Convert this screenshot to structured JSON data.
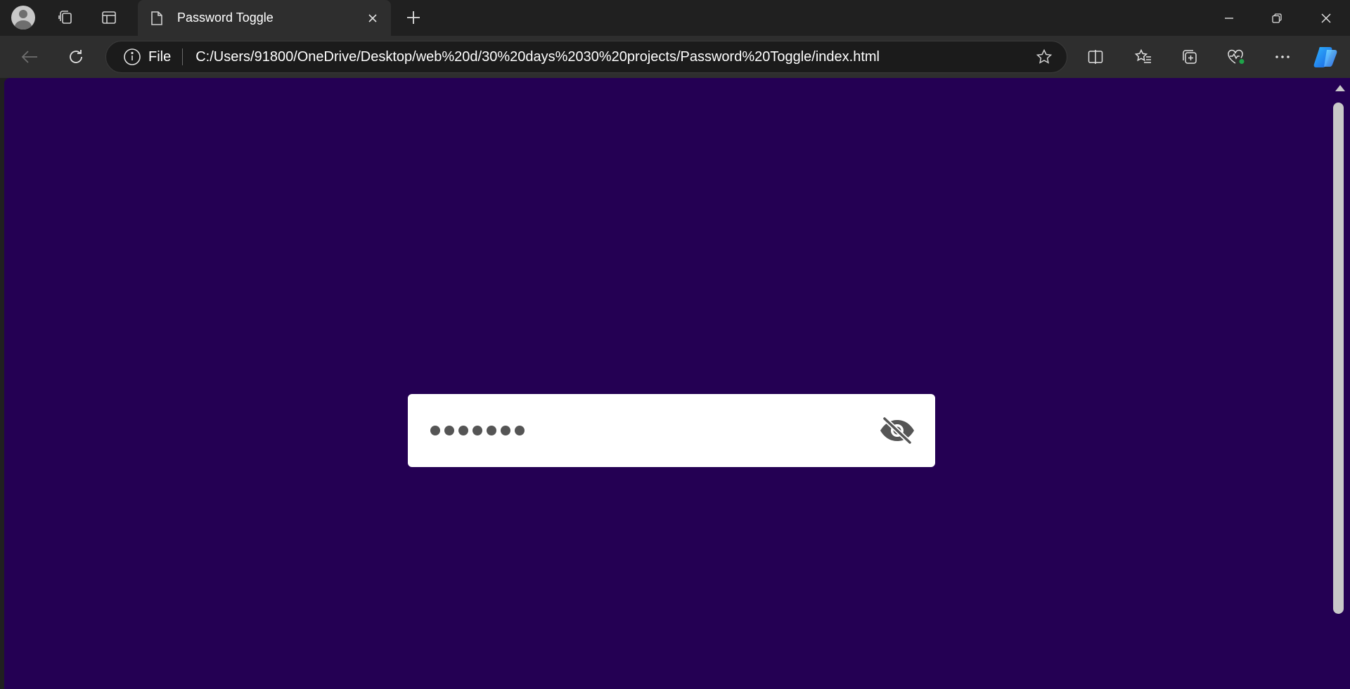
{
  "tab": {
    "title": "Password Toggle"
  },
  "address": {
    "scheme_label": "File",
    "url": "C:/Users/91800/OneDrive/Desktop/web%20d/30%20days%2030%20projects/Password%20Toggle/index.html"
  },
  "page": {
    "background": "#240053",
    "password": {
      "masked_length": 7,
      "dots": "•••••••"
    },
    "toggle_icon": "eye-slash-icon"
  },
  "colors": {
    "chrome_dark": "#202020",
    "toolbar": "#2e2e2e",
    "box": "#ffffff",
    "icon_grey": "#555555"
  }
}
